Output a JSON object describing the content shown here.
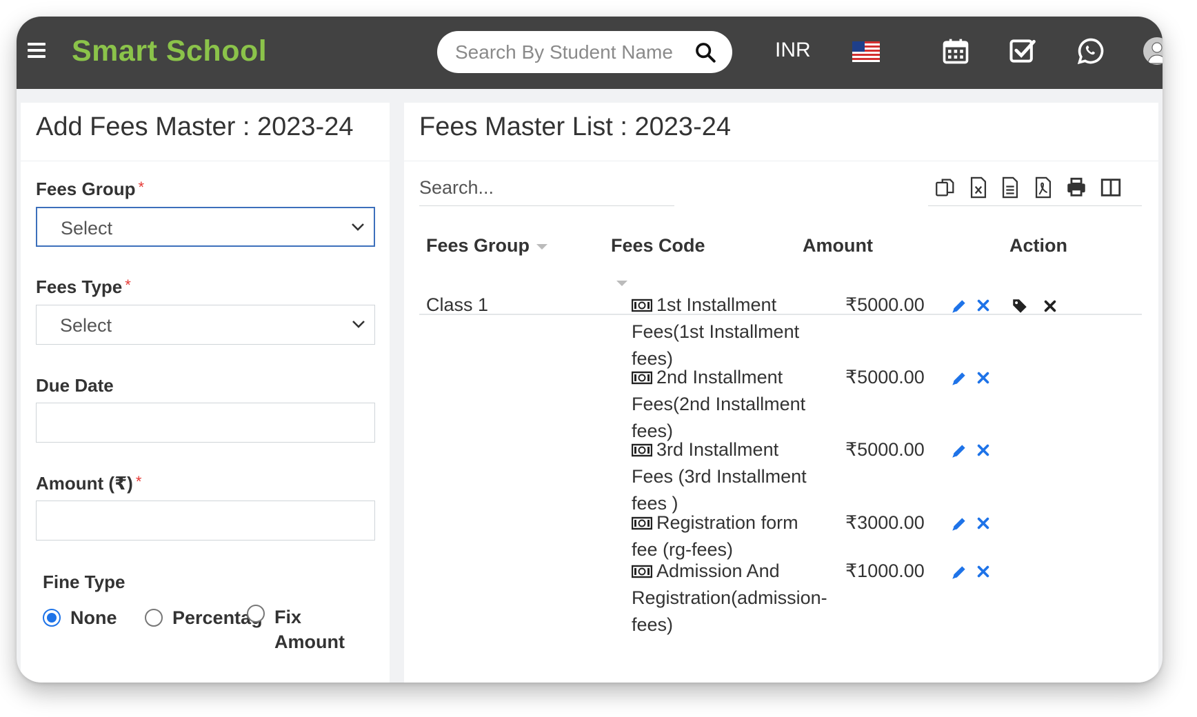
{
  "header": {
    "brand": "Smart School",
    "search_placeholder": "Search By Student Name",
    "currency": "INR"
  },
  "add_form": {
    "title": "Add Fees Master : 2023-24",
    "fees_group_label": "Fees Group",
    "fees_group_value": "Select",
    "fees_type_label": "Fees Type",
    "fees_type_value": "Select",
    "due_date_label": "Due Date",
    "amount_label": "Amount (₹)",
    "required_mark": "*",
    "fine_type_label": "Fine Type",
    "fine_options": [
      "None",
      "Percentag",
      "Fix Amount"
    ],
    "fine_selected": "None",
    "fix_line1": "Fix",
    "fix_line2": "Amount"
  },
  "list": {
    "title": "Fees Master List : 2023-24",
    "search_placeholder": "Search...",
    "toolbar_icons": [
      "copy-icon",
      "excel-icon",
      "csv-icon",
      "pdf-icon",
      "print-icon",
      "columns-icon"
    ],
    "columns": [
      "Fees Group",
      "Fees Code",
      "Amount",
      "Action"
    ],
    "group": "Class 1",
    "rows": [
      {
        "code_lines": [
          "1st Installment",
          "Fees(1st Installment",
          "fees)"
        ],
        "amount": "₹5000.00"
      },
      {
        "code_lines": [
          "2nd Installment",
          "Fees(2nd Installment",
          "fees)"
        ],
        "amount": "₹5000.00"
      },
      {
        "code_lines": [
          "3rd Installment",
          "Fees (3rd Installment",
          "fees )"
        ],
        "amount": "₹5000.00"
      },
      {
        "code_lines": [
          "Registration form",
          "fee (rg-fees)"
        ],
        "amount": "₹3000.00"
      },
      {
        "code_lines": [
          "Admission And",
          "Registration(admission-",
          "fees)"
        ],
        "amount": "₹1000.00"
      }
    ]
  },
  "colors": {
    "topbar": "#424242",
    "brand": "#8bc34a",
    "accent_blue": "#1e73e8",
    "required": "#e53935"
  }
}
